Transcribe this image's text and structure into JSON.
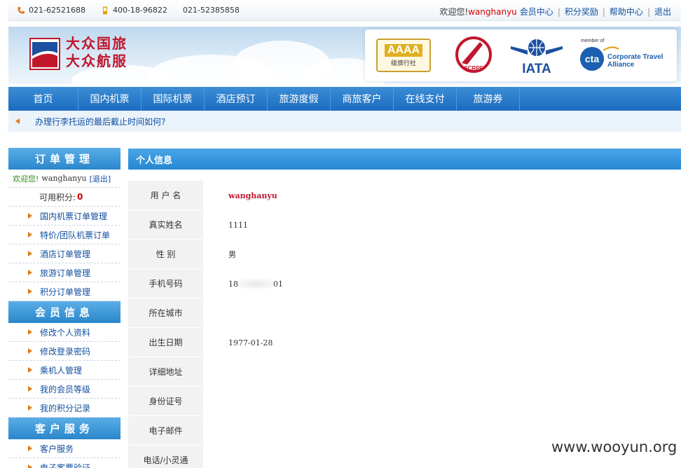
{
  "topbar": {
    "phone1": "021-62521688",
    "phone2": "400-18-96822",
    "phone3": "021-52385858",
    "welcome": "欢迎您!",
    "username": "wanghanyu",
    "links": [
      "会员中心",
      "积分奖励",
      "帮助中心",
      "退出"
    ]
  },
  "banner": {
    "logo_line1": "大众国旅",
    "logo_line2": "大众航服",
    "partners": {
      "aaaa": "AAAA",
      "aaaa_sub": "级旅行社",
      "scrpf": "SCRPF",
      "iata": "IATA",
      "cta_member": "member of",
      "cta_short": "cta",
      "cta_line1": "Corporate Travel",
      "cta_line2": "Alliance"
    }
  },
  "nav": [
    "首页",
    "国内机票",
    "国际机票",
    "酒店预订",
    "旅游度假",
    "商旅客户",
    "在线支付",
    "旅游券"
  ],
  "notice": "办理行李托运的最后截止时间如何?",
  "sidebar": {
    "order_title": "订单管理",
    "welcome": "欢迎您!",
    "username": "wanghanyu",
    "logout": "[退出]",
    "points_label": "可用积分:",
    "points_value": "0",
    "order_items": [
      "国内机票订单管理",
      "特价/团队机票订单",
      "酒店订单管理",
      "旅游订单管理",
      "积分订单管理"
    ],
    "member_title": "会员信息",
    "member_items": [
      "修改个人资料",
      "修改登录密码",
      "乘机人管理",
      "我的会员等级",
      "我的积分记录"
    ],
    "service_title": "客户服务",
    "service_items": [
      "客户服务",
      "电子客票验证"
    ]
  },
  "content": {
    "title": "个人信息",
    "rows": [
      {
        "label": "用 户 名",
        "value": "wanghanyu"
      },
      {
        "label": "真实姓名",
        "value": "1111"
      },
      {
        "label": "性 别",
        "value": "男"
      },
      {
        "label": "手机号码",
        "value_prefix": "18",
        "value_suffix": "01"
      },
      {
        "label": "所在城市",
        "value": ""
      },
      {
        "label": "出生日期",
        "value": "1977-01-28"
      },
      {
        "label": "详细地址",
        "value": ""
      },
      {
        "label": "身份证号",
        "value": ""
      },
      {
        "label": "电子邮件",
        "value": ""
      },
      {
        "label": "电话/小灵通",
        "value": ""
      }
    ]
  },
  "watermark": "www.wooyun.org",
  "colors": {
    "nav_blue": "#1b6cbf",
    "accent_red": "#d40000",
    "link_blue": "#114fa0",
    "arrow_orange": "#e07a18"
  }
}
